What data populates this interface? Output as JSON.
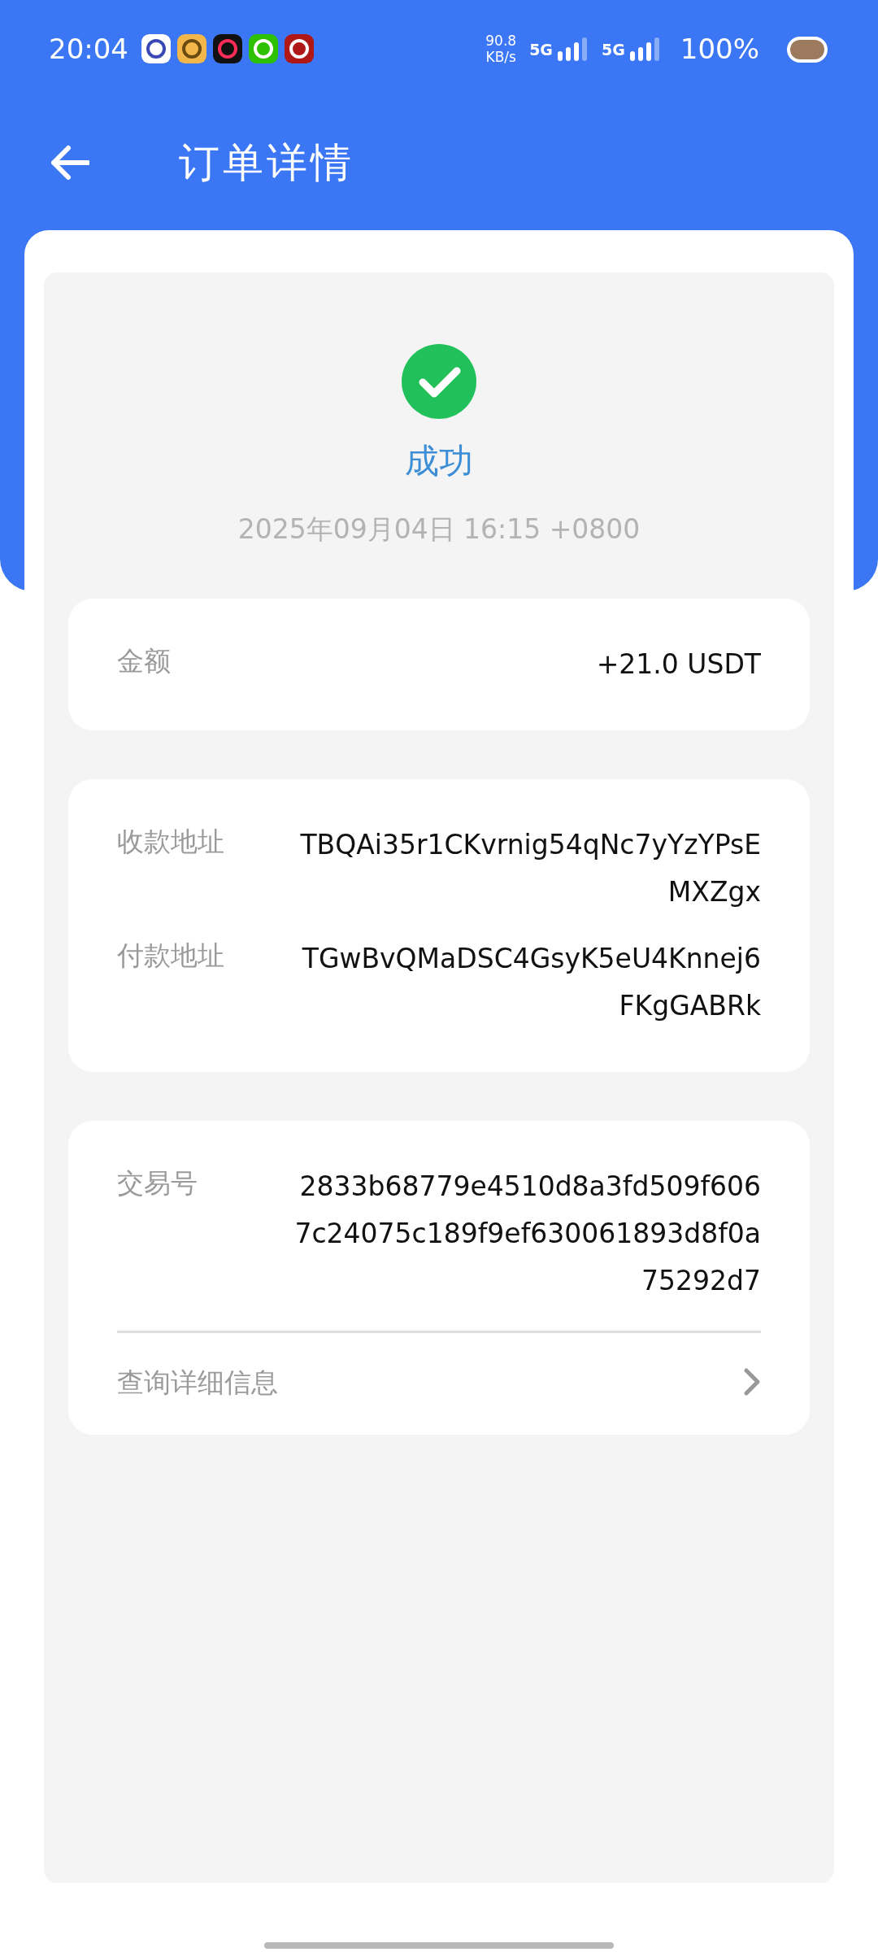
{
  "status_bar": {
    "time": "20:04",
    "net_speed": "90.8",
    "net_unit": "KB/s",
    "signals": [
      "5G",
      "5G"
    ],
    "battery": "100%"
  },
  "header": {
    "title": "订单详情"
  },
  "result": {
    "kind": "success",
    "label": "成功",
    "timestamp": "2025年09月04日 16:15 +0800"
  },
  "sections": [
    {
      "rows": [
        {
          "label": "金额",
          "value": "+21.0 USDT"
        }
      ]
    },
    {
      "rows": [
        {
          "label": "收款地址",
          "value": "TBQAi35r1CKvrnig54qNc7yYzYPsEMXZgx"
        },
        {
          "label": "付款地址",
          "value": "TGwBvQMaDSC4GsyK5eU4Knnej6FKgGABRk"
        }
      ]
    },
    {
      "rows": [
        {
          "label": "交易号",
          "value": "2833b68779e4510d8a3fd509f6067c24075c189f9ef630061893d8f0a75292d7"
        }
      ],
      "link": {
        "label": "查询详细信息"
      }
    }
  ]
}
